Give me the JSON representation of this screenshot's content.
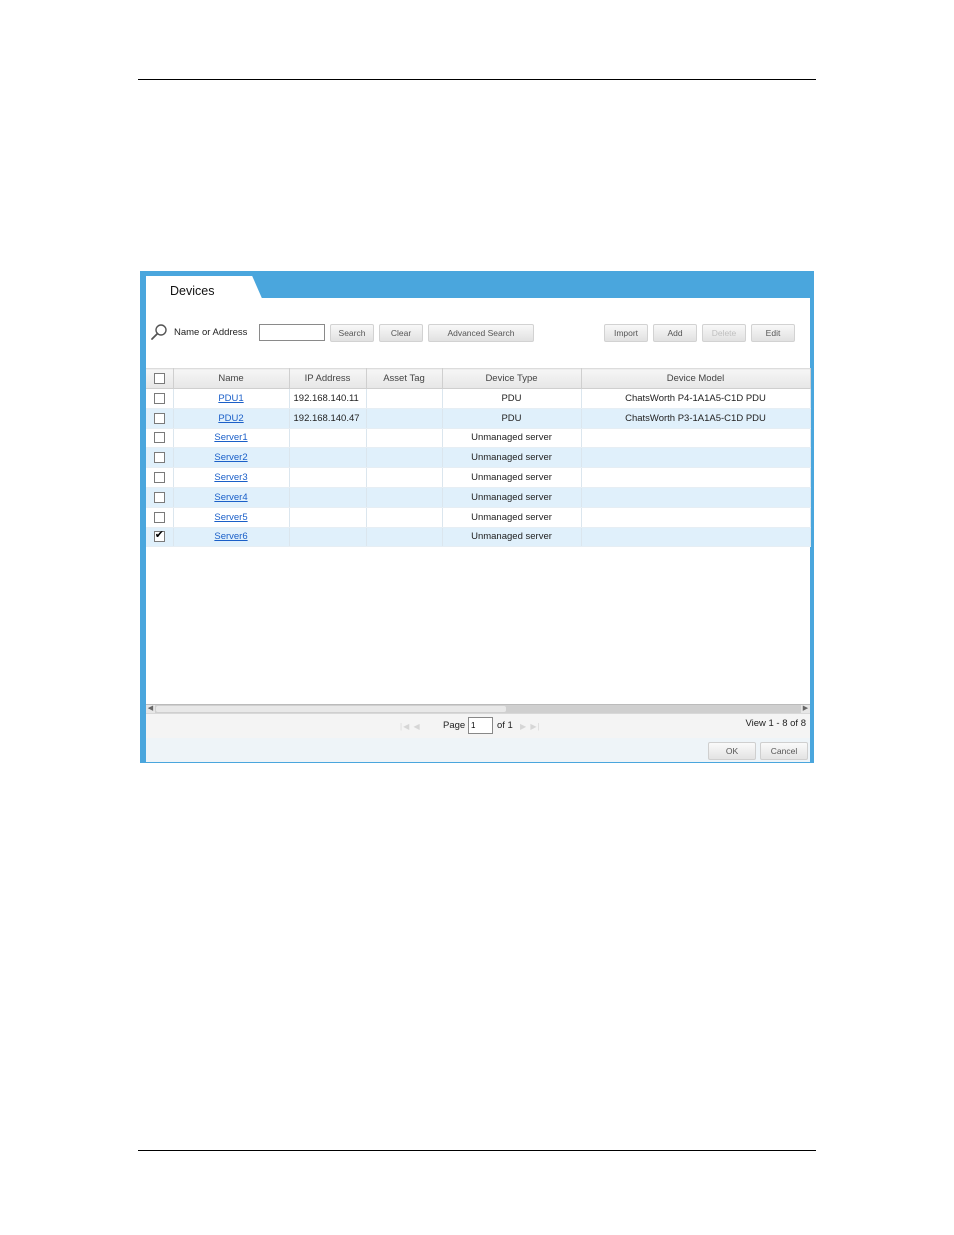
{
  "dialog": {
    "tab_title": "Devices"
  },
  "toolbar": {
    "search_label": "Name or Address",
    "search_value": "",
    "search_button": "Search",
    "clear_button": "Clear",
    "advanced_search_button": "Advanced Search",
    "import_button": "Import",
    "add_button": "Add",
    "delete_button": "Delete",
    "edit_button": "Edit"
  },
  "table": {
    "columns": [
      "Name",
      "IP Address",
      "Asset Tag",
      "Device Type",
      "Device Model"
    ],
    "rows": [
      {
        "checked": false,
        "name": "PDU1",
        "ip": "192.168.140.11",
        "asset_tag": "",
        "type": "PDU",
        "model": "ChatsWorth P4-1A1A5-C1D PDU"
      },
      {
        "checked": false,
        "name": "PDU2",
        "ip": "192.168.140.47",
        "asset_tag": "",
        "type": "PDU",
        "model": "ChatsWorth P3-1A1A5-C1D PDU"
      },
      {
        "checked": false,
        "name": "Server1",
        "ip": "",
        "asset_tag": "",
        "type": "Unmanaged server",
        "model": ""
      },
      {
        "checked": false,
        "name": "Server2",
        "ip": "",
        "asset_tag": "",
        "type": "Unmanaged server",
        "model": ""
      },
      {
        "checked": false,
        "name": "Server3",
        "ip": "",
        "asset_tag": "",
        "type": "Unmanaged server",
        "model": ""
      },
      {
        "checked": false,
        "name": "Server4",
        "ip": "",
        "asset_tag": "",
        "type": "Unmanaged server",
        "model": ""
      },
      {
        "checked": false,
        "name": "Server5",
        "ip": "",
        "asset_tag": "",
        "type": "Unmanaged server",
        "model": ""
      },
      {
        "checked": true,
        "name": "Server6",
        "ip": "",
        "asset_tag": "",
        "type": "Unmanaged server",
        "model": ""
      }
    ]
  },
  "pager": {
    "page_label": "Page",
    "page_value": "1",
    "of_label": "of 1",
    "view_label": "View 1 - 8 of 8"
  },
  "footer": {
    "ok_button": "OK",
    "cancel_button": "Cancel"
  },
  "icons": {
    "search": "search-icon",
    "check": "checkmark-icon"
  },
  "colors": {
    "window_frame": "#4aa6dd",
    "alt_row": "#e0f0fb",
    "link": "#1a5fc8"
  }
}
